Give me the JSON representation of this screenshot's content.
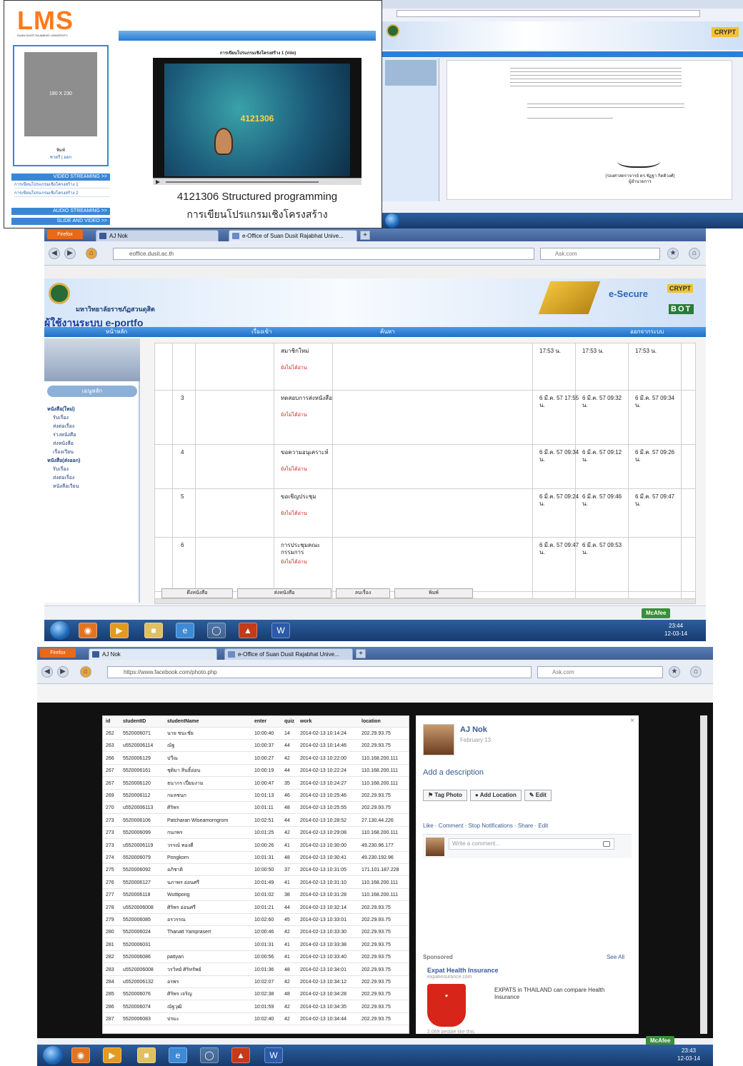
{
  "panel_lms": {
    "logo_text": "LMS",
    "logo_subtitle": "SUAN DUSIT RAJABHAT UNIVERSITY",
    "nav_items": [
      "",
      "",
      "",
      "",
      ""
    ],
    "avatar_placeholder": "180 X 230",
    "user_line_1": "พิมพ์",
    "user_line_2": "ชาตรี | ออก",
    "side_buttons": [
      "VIDEO STREAMING >>",
      "AUDIO STREAMING >>",
      "SLIDE AND VIDEO >>"
    ],
    "side_links": [
      "การเขียนโปรแกรมเชิงโครงสร้าง 1",
      "การเขียนโปรแกรมเชิงโครงสร้าง 2"
    ],
    "video_heading": "การเขียนโปรแกรมเชิงโครงสร้าง 1 (Vdo)",
    "video_overlay_code": "4121306",
    "course_title": "4121306 Structured programming",
    "course_title_th": "การเขียนโปรแกรมเชิงโครงสร้าง"
  },
  "panel_letter": {
    "signature_name": "(รองศาสตราจารย์ ดร.ชัฏฐา กิตติวงศ์)",
    "signature_role": "ผู้อำนวยการ",
    "brand_right": "CRYPT"
  },
  "panel_eoffice": {
    "tabs": [
      {
        "label": "AJ Nok",
        "active": false
      },
      {
        "label": "e-Office of Suan Dusit Rajabhat Unive...",
        "active": true
      }
    ],
    "url": "eoffice.dusit.ac.th",
    "search_placeholder": "Ask.com",
    "site_title": "มหาวิทยาลัยราชภัฏสวนดุสิต",
    "site_subtitle": "ผู้ใช้งานระบบ e-portfo",
    "brand_right": [
      "e-Secure",
      "CRYPT",
      "BOT"
    ],
    "menu_bar": [
      "หน้าหลัก",
      "เรื่องเข้า",
      "ค้นหา",
      "ออกจากระบบ"
    ],
    "sidebar_menu_title": "เมนูหลัก",
    "sidebar_items": [
      "หนังสือ(ใหม่)",
      "รับเรื่อง",
      "ส่งต่อเรื่อง",
      "ร่างหนังสือ",
      "ส่งหนังสือ",
      "เรื่องเวียน",
      "หนังสือ(ส่งออก)",
      "รับเรื่อง",
      "ส่งต่อเรื่อง",
      "หนังสือเวียน"
    ],
    "rows": [
      {
        "no": "",
        "idx": "",
        "doc": "สมาชิกใหม่",
        "status": "ยังไม่ได้อ่าน",
        "d1": "17:53 น.",
        "d2": "17:53 น.",
        "d3": "17:53 น."
      },
      {
        "no": "",
        "idx": "3",
        "doc": "ทดสอบการส่งหนังสือ",
        "status": "ยังไม่ได้อ่าน",
        "d1": "6 มี.ค. 57 17:55 น.",
        "d2": "6 มี.ค. 57 09:32 น.",
        "d3": "6 มี.ค. 57 09:34 น."
      },
      {
        "no": "",
        "idx": "4",
        "doc": "ขอความอนุเคราะห์",
        "status": "ยังไม่ได้อ่าน",
        "d1": "6 มี.ค. 57 09:34 น.",
        "d2": "6 มี.ค. 57 09:12 น.",
        "d3": "6 มี.ค. 57 09:26 น."
      },
      {
        "no": "",
        "idx": "5",
        "doc": "ขอเชิญประชุม",
        "status": "ยังไม่ได้อ่าน",
        "d1": "6 มี.ค. 57 09:24 น.",
        "d2": "6 มี.ค. 57 09:46 น.",
        "d3": "6 มี.ค. 57 09:47 น."
      },
      {
        "no": "",
        "idx": "6",
        "doc": "การประชุมคณะกรรมการ",
        "status": "ยังไม่ได้อ่าน",
        "d1": "6 มี.ค. 57 09:47 น.",
        "d2": "6 มี.ค. 57 09:53 น.",
        "d3": ""
      }
    ],
    "bottom_buttons": [
      "ดึงหนังสือ",
      "ส่งหนังสือ",
      "ลบเรื่อง",
      "พิมพ์"
    ],
    "mcafee": "McAfee",
    "clock_time": "23:44",
    "clock_date": "12-03-14"
  },
  "panel_facebook": {
    "tabs": [
      {
        "label": "AJ Nok",
        "active": true
      },
      {
        "label": "e-Office of Suan Dusit Rajabhat Unive...",
        "active": false
      }
    ],
    "url": "https://www.facebook.com/photo.php",
    "search_placeholder": "Ask.com",
    "table_headers": [
      "id",
      "studentID",
      "studentName",
      "enter",
      "quiz",
      "work",
      "location"
    ],
    "table_rows": [
      [
        "262",
        "5520006071",
        "นาย ชนะชัย",
        "10:00:40",
        "14",
        "2014-02-13 10:14:24",
        "202.29.93.75"
      ],
      [
        "263",
        "u5520006114",
        "ณัฐ",
        "10:00:37",
        "44",
        "2014-02-13 10:14:46",
        "202.29.93.75"
      ],
      [
        "266",
        "5520006129",
        "ปวีณ",
        "10:00:27",
        "42",
        "2014-02-13 10:22:00",
        "110.168.200.111"
      ],
      [
        "267",
        "5520006161",
        "ชุติมา สินธิ์อ่อน",
        "10:00:19",
        "44",
        "2014-02-13 10:22:24",
        "110.168.200.111"
      ],
      [
        "267",
        "5520006120",
        "ธนากร เปี่ยมงาม",
        "10:00:47",
        "35",
        "2014-02-13 10:24:27",
        "110.168.200.111"
      ],
      [
        "269",
        "5520006112",
        "กมลชนก",
        "10:01:13",
        "46",
        "2014-02-13 10:25:46",
        "202.29.93.75"
      ],
      [
        "270",
        "u5520006113",
        "ศิริพร",
        "10:01:11",
        "48",
        "2014-02-13 10:25:55",
        "202.29.93.75"
      ],
      [
        "273",
        "5520006106",
        "Patcharan Wiseamorngrom",
        "10:02:51",
        "44",
        "2014-02-13 10:28:52",
        "27.130.44.226"
      ],
      [
        "273",
        "5520006099",
        "กนกพร",
        "10:01:25",
        "42",
        "2014-02-13 10:29:08",
        "110.168.200.111"
      ],
      [
        "273",
        "u5520006119",
        "วรรณ์ ทองดี",
        "10:00:26",
        "41",
        "2014-02-13 10:30:00",
        "49.230.96.177"
      ],
      [
        "274",
        "5520006079",
        "Pongkorn",
        "10:01:31",
        "48",
        "2014-02-13 10:30:41",
        "49.230.192.96"
      ],
      [
        "275",
        "5520006092",
        "อภิชาติ",
        "10:00:50",
        "37",
        "2014-02-13 10:31:05",
        "171.101.187.228"
      ],
      [
        "276",
        "5520006127",
        "นภาพร อ่อนศรี",
        "10:01:49",
        "41",
        "2014-02-13 10:31:10",
        "110.168.200.111"
      ],
      [
        "277",
        "5520006118",
        "Wuttipong",
        "10:01:02",
        "38",
        "2014-02-13 10:31:28",
        "110.168.200.111"
      ],
      [
        "278",
        "u5520006008",
        "ศิริพร อ่อนศรี",
        "10:01:21",
        "44",
        "2014-02-13 10:32:14",
        "202.29.93.75"
      ],
      [
        "279",
        "5520006085",
        "อรวรรณ",
        "10:02:60",
        "45",
        "2014-02-13 10:33:01",
        "202.29.93.75"
      ],
      [
        "280",
        "5520006024",
        "Thanatt Yamprasert",
        "10:00:46",
        "42",
        "2014-02-13 10:33:30",
        "202.29.93.75"
      ],
      [
        "281",
        "5520006031",
        "",
        "10:01:31",
        "41",
        "2014-02-13 10:33:38",
        "202.29.93.75"
      ],
      [
        "282",
        "5520006086",
        "pattyan",
        "10:00:56",
        "41",
        "2014-02-13 10:33:40",
        "202.29.93.75"
      ],
      [
        "283",
        "u5520006008",
        "วรวิทย์ ศิริทรัพย์",
        "10:01:36",
        "48",
        "2014-02-13 10:34:01",
        "202.29.93.75"
      ],
      [
        "284",
        "u5520006132",
        "อรพร",
        "10:02:07",
        "42",
        "2014-02-13 10:34:12",
        "202.29.93.75"
      ],
      [
        "285",
        "5520006076",
        "ศิริพร เจริญ",
        "10:02:38",
        "48",
        "2014-02-13 10:34:28",
        "202.29.93.75"
      ],
      [
        "286",
        "5520006074",
        "ณัฐวุฒิ",
        "10:01:59",
        "42",
        "2014-02-13 10:34:35",
        "202.29.93.75"
      ],
      [
        "287",
        "5520006083",
        "ปรมะ",
        "10:02:40",
        "42",
        "2014-02-13 10:34:44",
        "202.29.93.75"
      ]
    ],
    "profile_name": "AJ Nok",
    "profile_date": "February 13",
    "add_description": "Add a description",
    "btn_tag": "Tag Photo",
    "btn_location": "Add Location",
    "btn_edit": "Edit",
    "action_links": "Like · Comment · Stop Notifications · Share · Edit",
    "comment_placeholder": "Write a comment...",
    "sponsored_label": "Sponsored",
    "see_all": "See All",
    "ad_title": "Expat Health Insurance",
    "ad_url": "expatinsurance.com",
    "ad_body": "EXPATS in THAILAND can compare Health Insurance",
    "ad_likes": "2,069 people like this.",
    "mcafee": "McAfee",
    "clock_time": "23:43",
    "clock_date": "12-03-14"
  },
  "colors": {
    "facebook_blue": "#3b5998",
    "eoffice_menu": "#2c7fd4",
    "lms_blue": "#2b7bd0"
  }
}
